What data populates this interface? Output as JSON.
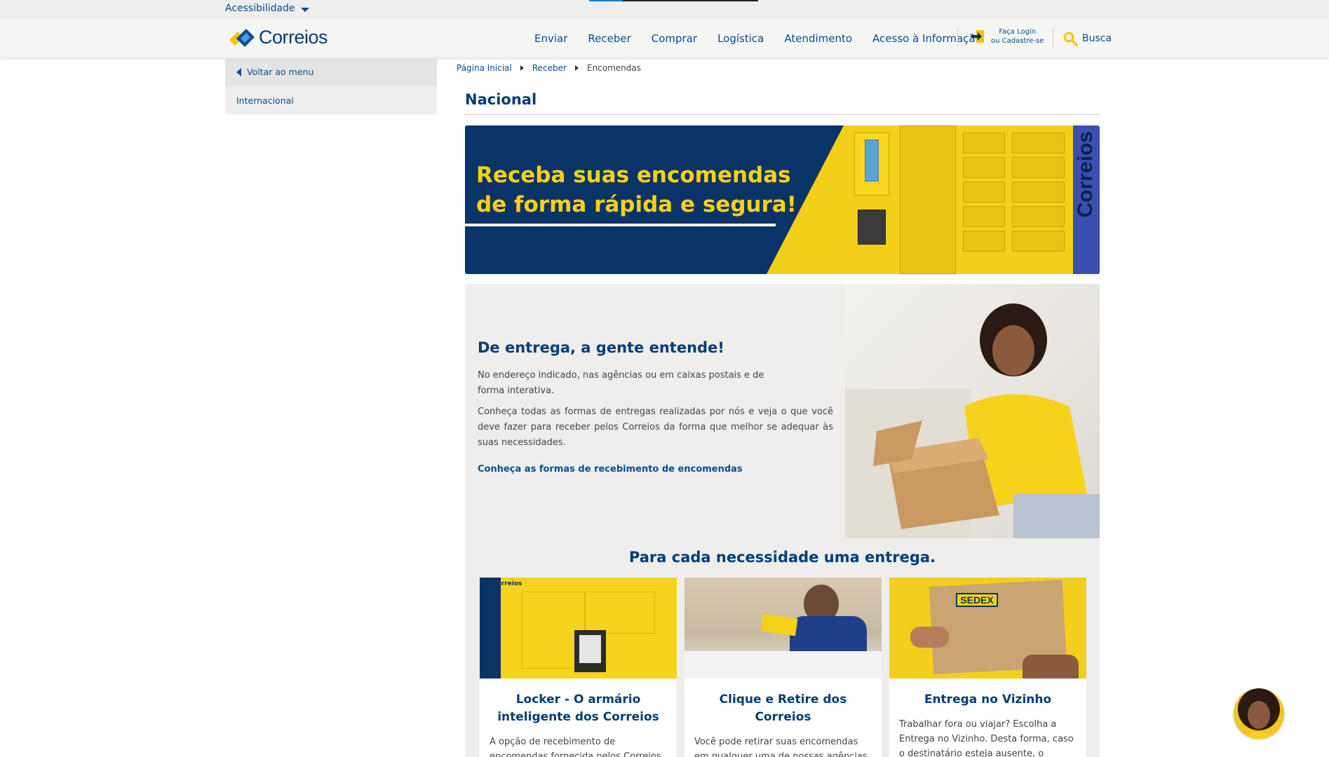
{
  "topbar": {
    "accessibility_label": "Acessibilidade"
  },
  "header": {
    "brand": "Correios",
    "nav": [
      "Enviar",
      "Receber",
      "Comprar",
      "Logística",
      "Atendimento",
      "Acesso à Informação"
    ],
    "login_line1": "Faça Login",
    "login_line2": "ou Cadastre-se",
    "search_label": "Busca"
  },
  "sidebar": {
    "back_label": "Voltar ao menu",
    "items": [
      "Internacional"
    ]
  },
  "breadcrumb": [
    "Página Inicial",
    "Receber",
    "Encomendas"
  ],
  "page": {
    "title": "Nacional"
  },
  "banner": {
    "line1": "Receba suas encomendas",
    "line2": "de forma rápida e segura!",
    "side_brand": "Correios"
  },
  "feature": {
    "heading": "De entrega, a gente entende!",
    "p1": "No endereço indicado, nas agências ou em caixas postais e de forma interativa.",
    "p2": "Conheça todas as formas de entregas realizadas por nós e veja o que você deve fazer para receber pelos Correios da forma que melhor se adequar às suas necessidades.",
    "link": "Conheça as formas de recebimento de encomendas"
  },
  "section": {
    "title": "Para cada necessidade uma entrega."
  },
  "cards": [
    {
      "title": "Locker - O armário inteligente dos Correios",
      "text": "A opção de recebimento de encomendas fornecida pelos Correios"
    },
    {
      "title": "Clique e Retire dos Correios",
      "text": "Você pode retirar suas encomendas em qualquer uma de nossas agências. Para isto, basta fornecer o endereço e"
    },
    {
      "title": "Entrega no Vizinho",
      "text": "Trabalhar fora ou viajar? Escolha a Entrega no Vizinho. Desta forma, caso o destinatário esteja ausente, o"
    }
  ],
  "card_logo_text": "Correios",
  "sedex_label": "SEDEX",
  "colors": {
    "brand_blue": "#003d79",
    "link_blue": "#0a4d8c",
    "brand_yellow": "#f2d01a"
  }
}
